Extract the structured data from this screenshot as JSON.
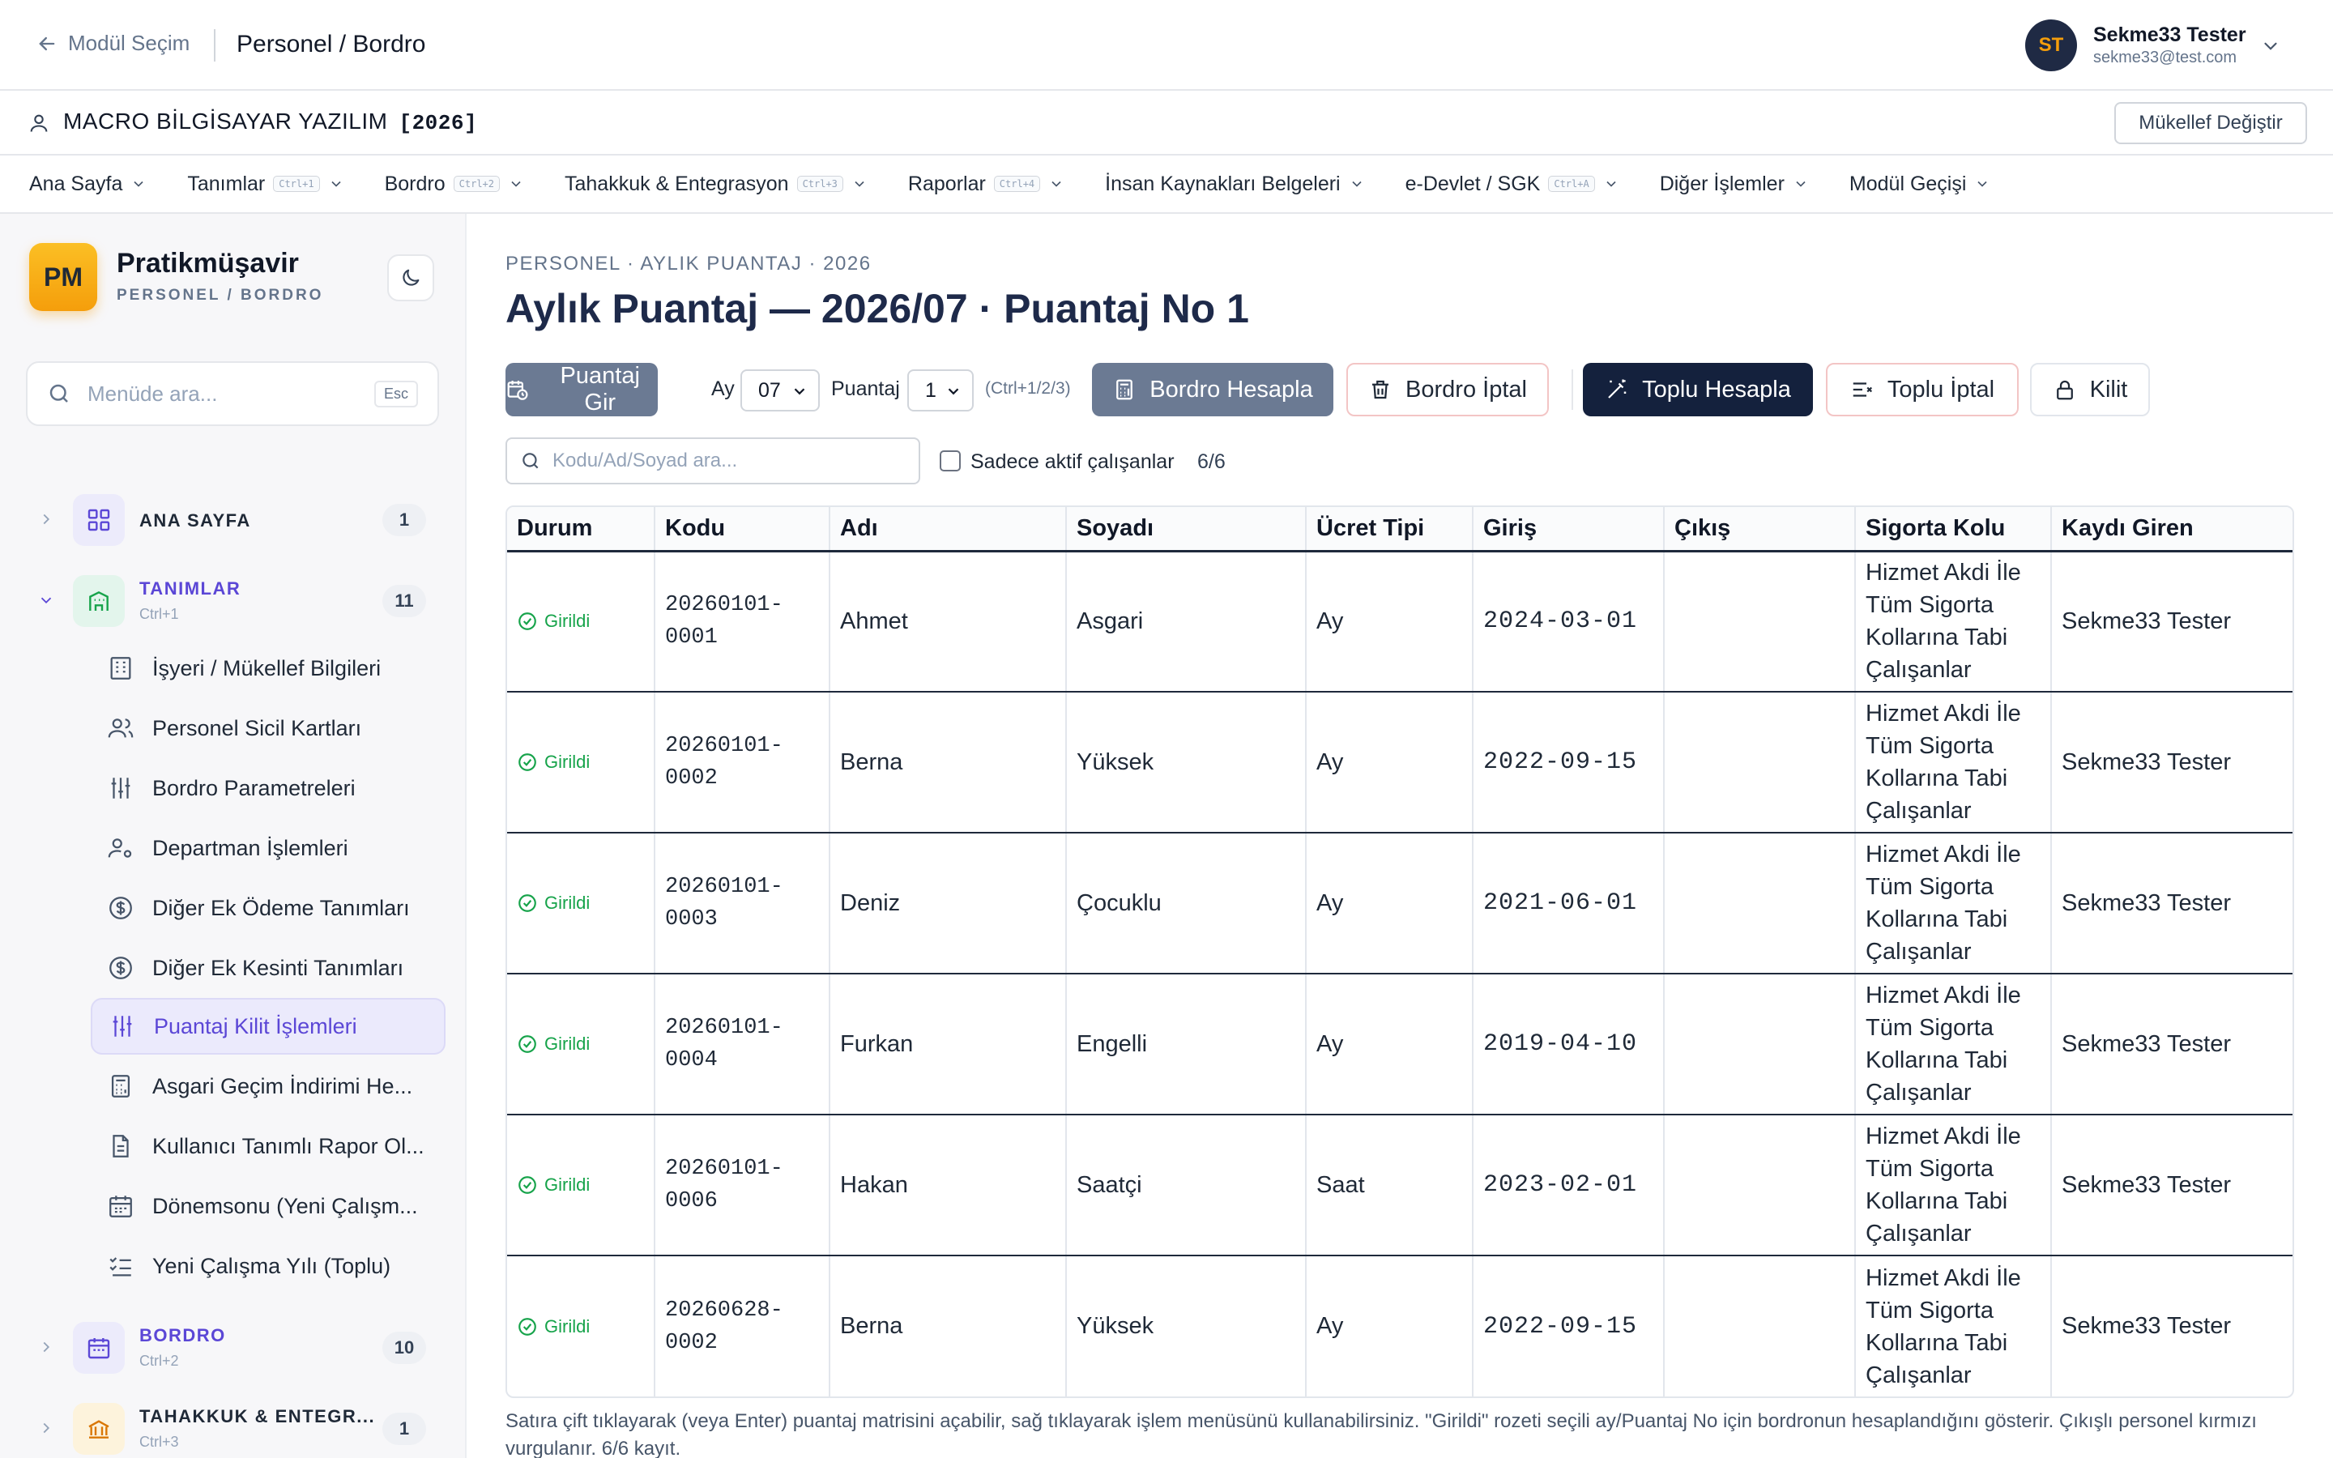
{
  "topbar": {
    "back_label": "Modül Seçim",
    "module_title": "Personel / Bordro",
    "user": {
      "initials": "ST",
      "name": "Sekme33 Tester",
      "email": "sekme33@test.com"
    }
  },
  "company": {
    "name": "MACRO BİLGİSAYAR YAZILIM",
    "year": "[2026]",
    "change_label": "Mükellef Değiştir"
  },
  "menu": [
    {
      "label": "Ana Sayfa",
      "kbd": ""
    },
    {
      "label": "Tanımlar",
      "kbd": "Ctrl+1"
    },
    {
      "label": "Bordro",
      "kbd": "Ctrl+2"
    },
    {
      "label": "Tahakkuk & Entegrasyon",
      "kbd": "Ctrl+3"
    },
    {
      "label": "Raporlar",
      "kbd": "Ctrl+4"
    },
    {
      "label": "İnsan Kaynakları Belgeleri",
      "kbd": ""
    },
    {
      "label": "e-Devlet / SGK",
      "kbd": "Ctrl+A"
    },
    {
      "label": "Diğer İşlemler",
      "kbd": ""
    },
    {
      "label": "Modül Geçişi",
      "kbd": ""
    }
  ],
  "sidebar": {
    "brand": {
      "logo": "PM",
      "name": "Pratikmüşavir",
      "sub": "PERSONEL / BORDRO"
    },
    "search_placeholder": "Menüde ara...",
    "esc": "Esc",
    "groups": [
      {
        "title": "ANA SAYFA",
        "kbd": "",
        "count": "1"
      },
      {
        "title": "TANIMLAR",
        "kbd": "Ctrl+1",
        "count": "11"
      },
      {
        "title": "BORDRO",
        "kbd": "Ctrl+2",
        "count": "10"
      },
      {
        "title": "TAHAKKUK & ENTEGR...",
        "kbd": "Ctrl+3",
        "count": "1"
      }
    ],
    "items": [
      "İşyeri / Mükellef Bilgileri",
      "Personel Sicil Kartları",
      "Bordro Parametreleri",
      "Departman İşlemleri",
      "Diğer Ek Ödeme Tanımları",
      "Diğer Ek Kesinti Tanımları",
      "Puantaj Kilit İşlemleri",
      "Asgari Geçim İndirimi He...",
      "Kullanıcı Tanımlı Rapor Ol...",
      "Dönemsonu (Yeni Çalışm...",
      "Yeni Çalışma Yılı (Toplu)"
    ],
    "active_item": "Puantaj Kilit İşlemleri"
  },
  "main": {
    "breadcrumb": "PERSONEL · AYLIK PUANTAJ · 2026",
    "title": "Aylık Puantaj — 2026/07 · Puantaj No 1",
    "toolbar": {
      "puantaj_gir": "Puantaj Gir",
      "ay_label": "Ay",
      "ay_value": "07",
      "puantaj_label": "Puantaj",
      "puantaj_value": "1",
      "hint": "(Ctrl+1/2/3)",
      "bordro_hesapla": "Bordro Hesapla",
      "bordro_iptal": "Bordro İptal",
      "toplu_hesapla": "Toplu Hesapla",
      "toplu_iptal": "Toplu İptal",
      "kilit": "Kilit"
    },
    "filter": {
      "search_placeholder": "Kodu/Ad/Soyad ara...",
      "active_only_label": "Sadece aktif çalışanlar",
      "count": "6/6"
    },
    "table": {
      "columns": [
        "Durum",
        "Kodu",
        "Adı",
        "Soyadı",
        "Ücret Tipi",
        "Giriş",
        "Çıkış",
        "Sigorta Kolu",
        "Kaydı Giren"
      ],
      "rows": [
        {
          "status": "Girildi",
          "code": "20260101-0001",
          "name": "Ahmet",
          "surname": "Asgari",
          "wage": "Ay",
          "start": "2024-03-01",
          "end": "",
          "insurance": "Hizmet Akdi İle Tüm Sigorta Kollarına Tabi Çalışanlar",
          "entered_by": "Sekme33 Tester"
        },
        {
          "status": "Girildi",
          "code": "20260101-0002",
          "name": "Berna",
          "surname": "Yüksek",
          "wage": "Ay",
          "start": "2022-09-15",
          "end": "",
          "insurance": "Hizmet Akdi İle Tüm Sigorta Kollarına Tabi Çalışanlar",
          "entered_by": "Sekme33 Tester"
        },
        {
          "status": "Girildi",
          "code": "20260101-0003",
          "name": "Deniz",
          "surname": "Çocuklu",
          "wage": "Ay",
          "start": "2021-06-01",
          "end": "",
          "insurance": "Hizmet Akdi İle Tüm Sigorta Kollarına Tabi Çalışanlar",
          "entered_by": "Sekme33 Tester"
        },
        {
          "status": "Girildi",
          "code": "20260101-0004",
          "name": "Furkan",
          "surname": "Engelli",
          "wage": "Ay",
          "start": "2019-04-10",
          "end": "",
          "insurance": "Hizmet Akdi İle Tüm Sigorta Kollarına Tabi Çalışanlar",
          "entered_by": "Sekme33 Tester"
        },
        {
          "status": "Girildi",
          "code": "20260101-0006",
          "name": "Hakan",
          "surname": "Saatçi",
          "wage": "Saat",
          "start": "2023-02-01",
          "end": "",
          "insurance": "Hizmet Akdi İle Tüm Sigorta Kollarına Tabi Çalışanlar",
          "entered_by": "Sekme33 Tester"
        },
        {
          "status": "Girildi",
          "code": "20260628-0002",
          "name": "Berna",
          "surname": "Yüksek",
          "wage": "Ay",
          "start": "2022-09-15",
          "end": "",
          "insurance": "Hizmet Akdi İle Tüm Sigorta Kollarına Tabi Çalışanlar",
          "entered_by": "Sekme33 Tester"
        }
      ]
    },
    "footnote": "Satıra çift tıklayarak (veya Enter) puantaj matrisini açabilir, sağ tıklayarak işlem menüsünü kullanabilirsiniz. \"Girildi\" rozeti seçili ay/Puantaj No için bordronun hesaplandığını gösterir. Çıkışlı personel kırmızı vurgulanır. 6/6 kayıt."
  },
  "colors": {
    "accent": "#5b47d6",
    "brand": "#f59e0b",
    "navy": "#14213d",
    "status_ok": "#16a34a"
  }
}
